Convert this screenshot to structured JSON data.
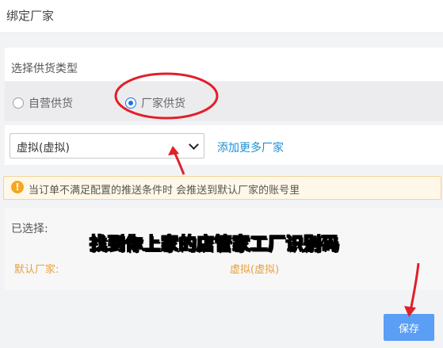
{
  "header": {
    "title": "绑定厂家"
  },
  "supply_type": {
    "label": "选择供货类型",
    "options": [
      {
        "label": "自营供货",
        "checked": false
      },
      {
        "label": "厂家供货",
        "checked": true
      }
    ]
  },
  "factory_select": {
    "value": "虚拟(虚拟)"
  },
  "add_more_link": "添加更多厂家",
  "notice": {
    "text": "当订单不满足配置的推送条件时 会推送到默认厂家的账号里"
  },
  "selected": {
    "label": "已选择:",
    "default_label": "默认厂家:",
    "default_value": "虚拟(虚拟)"
  },
  "caption": "找到你上家的店管家工厂识别码",
  "save_button": "保存",
  "colors": {
    "accent_blue": "#1a73e8",
    "link_blue": "#1a8fd9",
    "warning_orange": "#e6a23c",
    "annotation_red": "#e0202a",
    "save_blue": "#5b9ef5"
  }
}
